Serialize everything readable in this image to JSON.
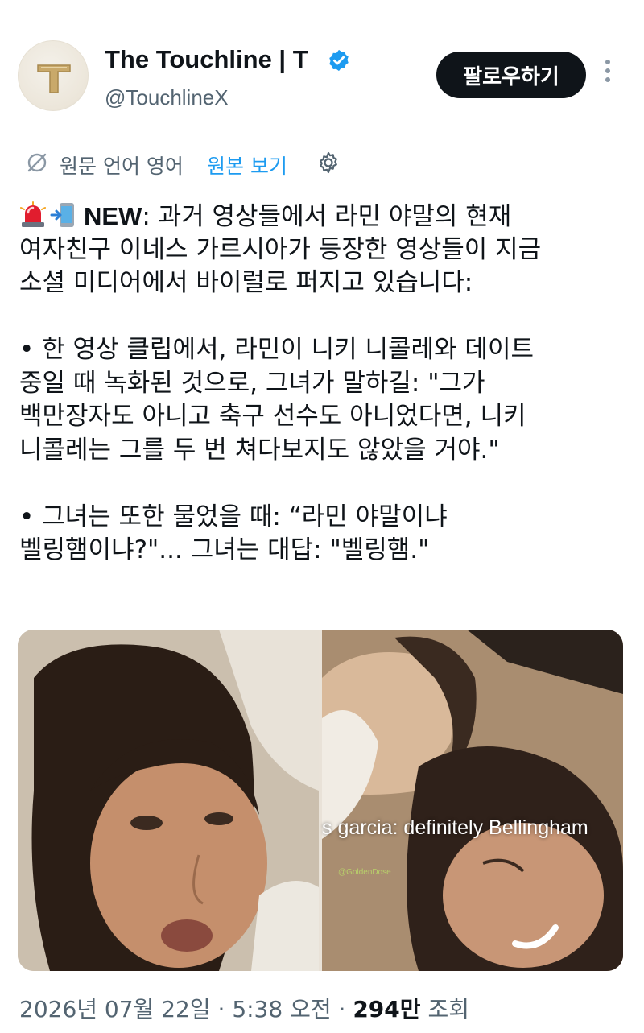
{
  "header": {
    "display_name": "The Touchline | T",
    "handle": "@TouchlineX",
    "follow_label": "팔로우하기"
  },
  "translation": {
    "label": "원문 언어 영어",
    "show_original": "원본 보기"
  },
  "tweet": {
    "lead_bold": "NEW",
    "lines": [
      ": 과거 영상들에서 라민 야말의 현재",
      "여자친구 이네스 가르시아가 등장한 영상들이 지금",
      "소셜 미디어에서 바이럴로 퍼지고 있습니다:",
      "• 한 영상 클립에서, 라민이 니키 니콜레와 데이트",
      "중일 때 녹화된 것으로, 그녀가 말하길: \"그가",
      "백만장자도 아니고 축구 선수도 아니었다면, 니키",
      "니콜레는 그를 두 번 쳐다보지도 않았을 거야.\"",
      "• 그녀는 또한 물었을 때: “라민 야말이냐",
      "벨링햄이냐?\"... 그녀는 대답: \"벨링햄.\""
    ]
  },
  "media": {
    "caption": "s garcia: definitely Bellingham",
    "watermark": "@GoldenDose"
  },
  "meta": {
    "date": "2026년 07월 22일",
    "sep1": " · ",
    "time": "5:38 오전",
    "sep2": " · ",
    "views": "294만",
    "views_label": " 조회"
  },
  "colors": {
    "text": "#0f1419",
    "secondary": "#536471",
    "link": "#1d9bf0",
    "follow_bg": "#0f1419",
    "verified": "#1d9bf0"
  },
  "icons": [
    "verified-badge-icon",
    "more-options-icon",
    "translate-icon",
    "settings-icon",
    "siren-emoji-icon",
    "phone-emoji-icon"
  ]
}
